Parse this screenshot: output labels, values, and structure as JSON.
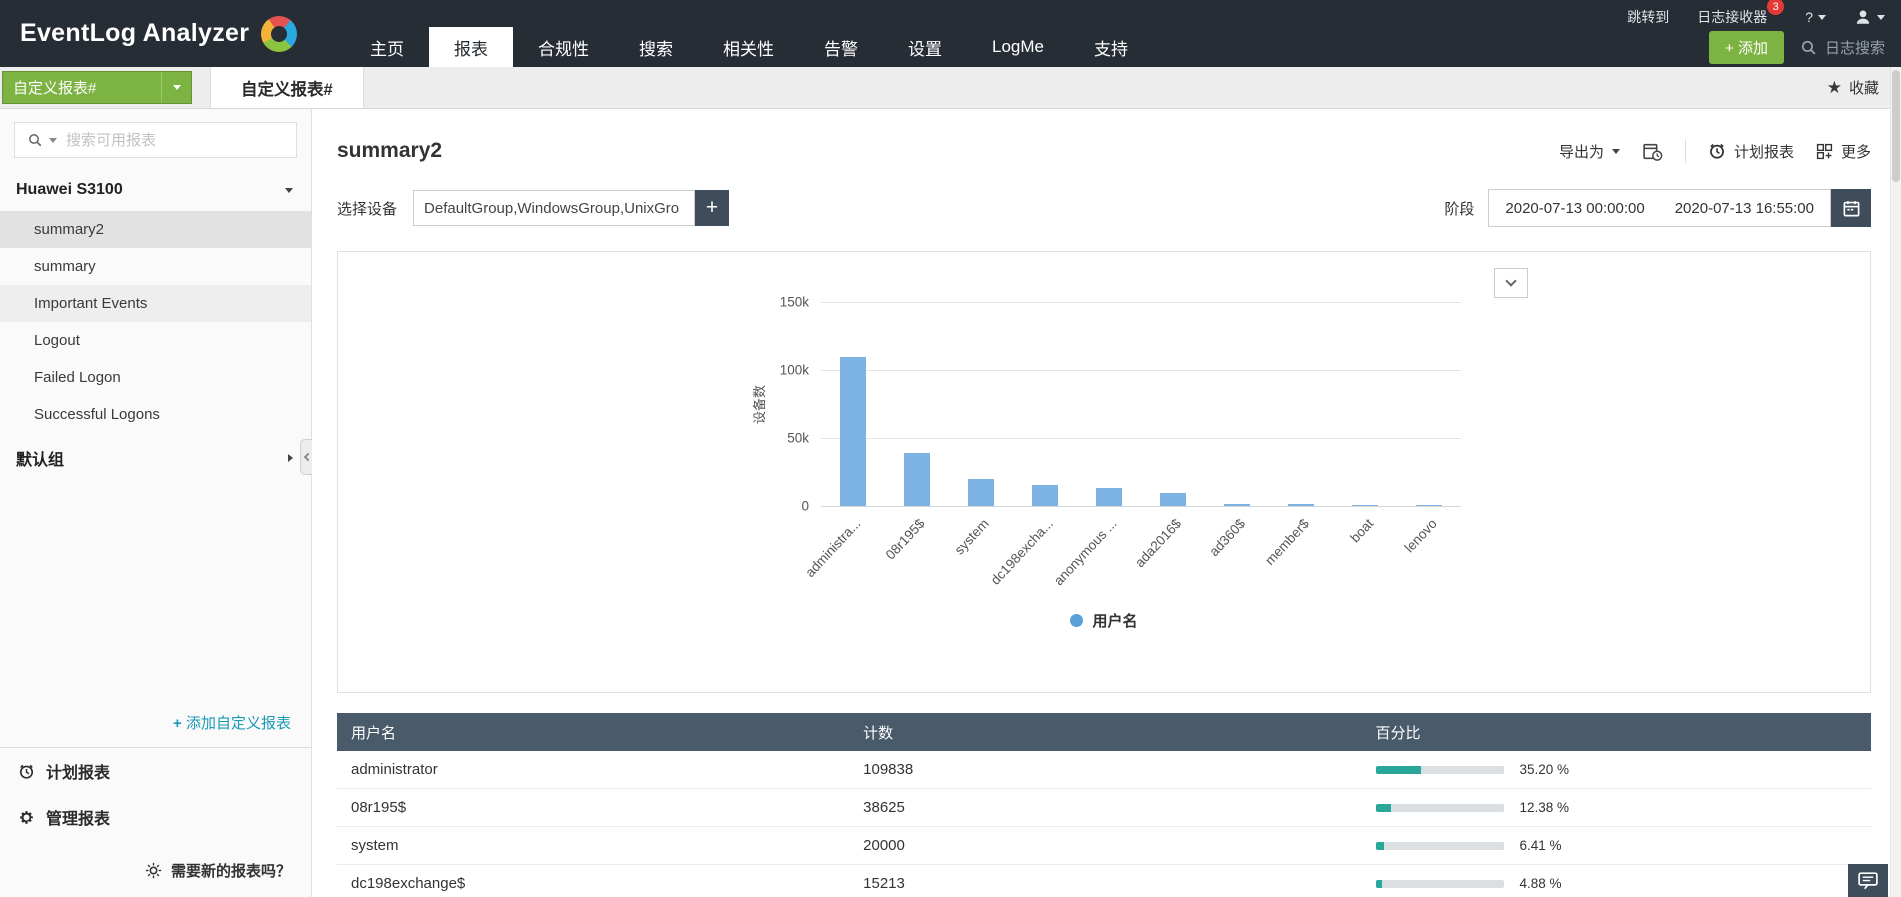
{
  "topbar": {
    "logo_text": "EventLog Analyzer",
    "nav": [
      {
        "label": "主页"
      },
      {
        "label": "报表"
      },
      {
        "label": "合规性"
      },
      {
        "label": "搜索"
      },
      {
        "label": "相关性"
      },
      {
        "label": "告警"
      },
      {
        "label": "设置"
      },
      {
        "label": "LogMe"
      },
      {
        "label": "支持"
      }
    ],
    "jump_to": "跳转到",
    "log_receiver": "日志接收器",
    "log_receiver_badge": "3",
    "help": "?",
    "add_button": "+ 添加",
    "log_search": "日志搜索"
  },
  "toolbar": {
    "report_group_dropdown": "自定义报表#",
    "active_tab": "自定义报表#",
    "favorite": "收藏"
  },
  "sidebar": {
    "search_placeholder": "搜索可用报表",
    "device_group": "Huawei S3100",
    "reports": [
      {
        "label": "summary2"
      },
      {
        "label": "summary"
      },
      {
        "label": "Important Events"
      },
      {
        "label": "Logout"
      },
      {
        "label": "Failed Logon"
      },
      {
        "label": "Successful Logons"
      }
    ],
    "default_group": "默认组",
    "add_custom_report": "添加自定义报表",
    "scheduled_reports": "计划报表",
    "manage_reports": "管理报表",
    "need_new_reports": "需要新的报表吗？"
  },
  "main": {
    "title": "summary2",
    "export_as": "导出为",
    "schedule_report": "计划报表",
    "more": "更多",
    "select_device_label": "选择设备",
    "device_value": "DefaultGroup,WindowsGroup,UnixGro",
    "period_label": "阶段",
    "period_start": "2020-07-13 00:00:00",
    "period_end": "2020-07-13 16:55:00"
  },
  "chart_data": {
    "type": "bar",
    "title": "",
    "categories": [
      "administra...",
      "08r195$",
      "system",
      "dc198excha...",
      "anonymous ...",
      "ada2016$",
      "ad360$",
      "member$",
      "boat",
      "lenovo"
    ],
    "values": [
      109838,
      38625,
      20000,
      15213,
      13000,
      9800,
      1600,
      1400,
      900,
      700
    ],
    "xlabel": "",
    "ylabel": "设备数",
    "ylim": [
      0,
      150000
    ],
    "yticks": [
      {
        "label": "150k",
        "value": 150000
      },
      {
        "label": "100k",
        "value": 100000
      },
      {
        "label": "50k",
        "value": 50000
      },
      {
        "label": "0",
        "value": 0
      }
    ],
    "grid": true,
    "legend_position": "bottom",
    "bar_color": "#7db3e3",
    "legend": [
      {
        "label": "用户名",
        "color": "#5b9fd8"
      }
    ]
  },
  "table": {
    "headers": [
      "用户名",
      "计数",
      "百分比"
    ],
    "rows": [
      {
        "name": "administrator",
        "count": "109838",
        "percent": 35.2,
        "percent_label": "35.20 %"
      },
      {
        "name": "08r195$",
        "count": "38625",
        "percent": 12.38,
        "percent_label": "12.38 %"
      },
      {
        "name": "system",
        "count": "20000",
        "percent": 6.41,
        "percent_label": "6.41 %"
      },
      {
        "name": "dc198exchange$",
        "count": "15213",
        "percent": 4.88,
        "percent_label": "4.88 %"
      }
    ]
  },
  "colors": {
    "topbar_bg": "#272d34",
    "accent_green": "#7cb342",
    "table_header_bg": "#495a6a",
    "progress_fill": "#29a79b",
    "bar_blue": "#7db3e3",
    "badge_red": "#e53935"
  }
}
